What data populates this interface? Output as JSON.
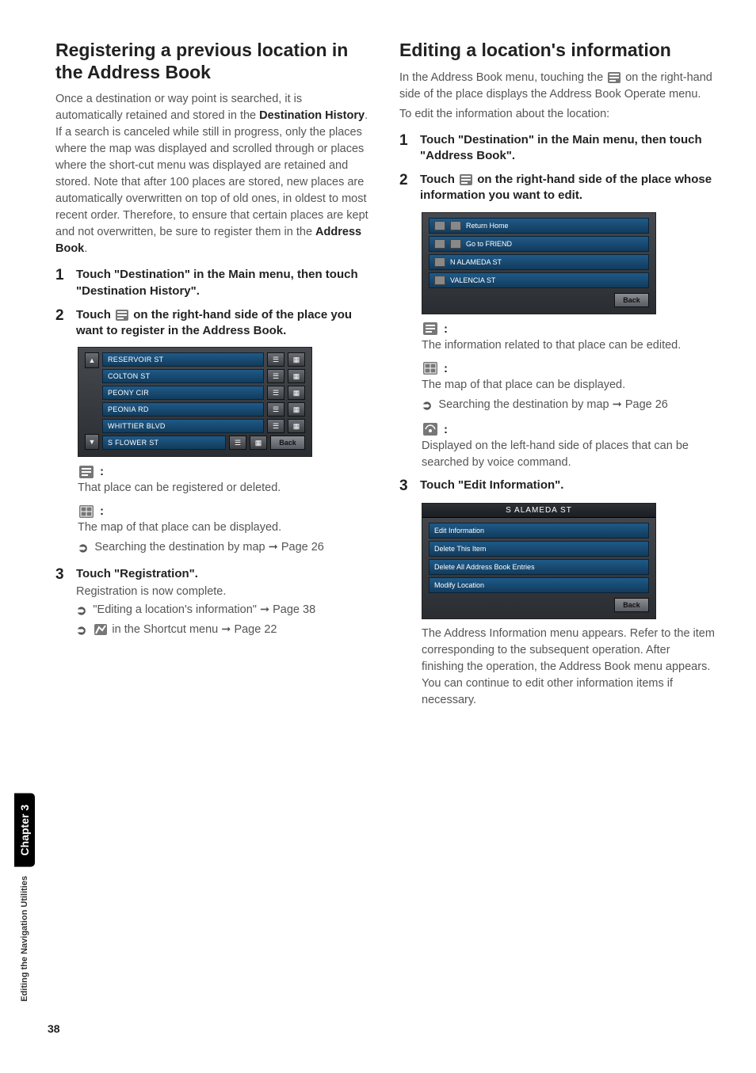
{
  "page_number": "38",
  "sidebar": {
    "chapter": "Chapter 3",
    "title": "Editing the Navigation Utilities"
  },
  "left": {
    "heading": "Registering a previous location in the Address Book",
    "intro_a": "Once a destination or way point is searched, it is automatically retained and stored in the ",
    "intro_bold1": "Destination History",
    "intro_b": ". If a search is canceled while still in progress, only the places where the map was displayed and scrolled through or places where the short-cut menu was displayed are retained and stored. Note that after 100 places are stored, new places are automatically overwritten on top of old ones, in oldest to most recent order. Therefore, to ensure that certain places are kept and not overwritten, be sure to register them in the ",
    "intro_bold2": "Address Book",
    "intro_c": ".",
    "step1": "Touch \"Destination\" in the Main menu, then touch \"Destination History\".",
    "step2a": "Touch ",
    "step2b": " on the right-hand side of the place you want to register in the Address Book.",
    "shot1_rows": [
      "RESERVOIR ST",
      "COLTON ST",
      "PEONY CIR",
      "PEONIA RD",
      "WHITTIER BLVD",
      "S FLOWER ST"
    ],
    "shot_back": "Back",
    "icon_edit_desc": "That place can be registered or deleted.",
    "icon_map_desc": "The map of that place can be displayed.",
    "ref_map": "Searching the destination by map ➞ Page 26",
    "step3": "Touch \"Registration\".",
    "step3_sub": "Registration is now complete.",
    "ref_edit": "\"Editing a location's information\" ➞ Page 38",
    "ref_shortcut_a": "",
    "ref_shortcut_b": " in the Shortcut menu ➞ Page 22"
  },
  "right": {
    "heading": "Editing a location's information",
    "intro_a": "In the Address Book menu, touching the ",
    "intro_b": " on the right-hand side of the place displays the Address Book Operate menu.",
    "intro_c": "To edit the information about the location:",
    "step1": "Touch \"Destination\" in the Main menu, then touch \"Address Book\".",
    "step2a": "Touch ",
    "step2b": " on the right-hand side of the place whose information you want to edit.",
    "shot2_rows": [
      "Return Home",
      "Go to FRIEND",
      "N ALAMEDA ST",
      "VALENCIA ST"
    ],
    "shot_back": "Back",
    "icon_edit_desc": "The information related to that place can be edited.",
    "icon_map_desc": "The map of that place can be displayed.",
    "ref_map": "Searching the destination by map ➞ Page 26",
    "icon_voice_desc": "Displayed on the left-hand side of places that can be searched by voice command.",
    "step3": "Touch \"Edit Information\".",
    "shot3_title": "S ALAMEDA ST",
    "shot3_rows": [
      "Edit Information",
      "Delete This Item",
      "Delete All Address Book Entries",
      "Modify Location"
    ],
    "post": "The Address Information menu appears. Refer to the item corresponding to the subsequent operation. After finishing the operation, the Address Book menu appears. You can continue to edit other information items if necessary."
  },
  "colon": ":"
}
